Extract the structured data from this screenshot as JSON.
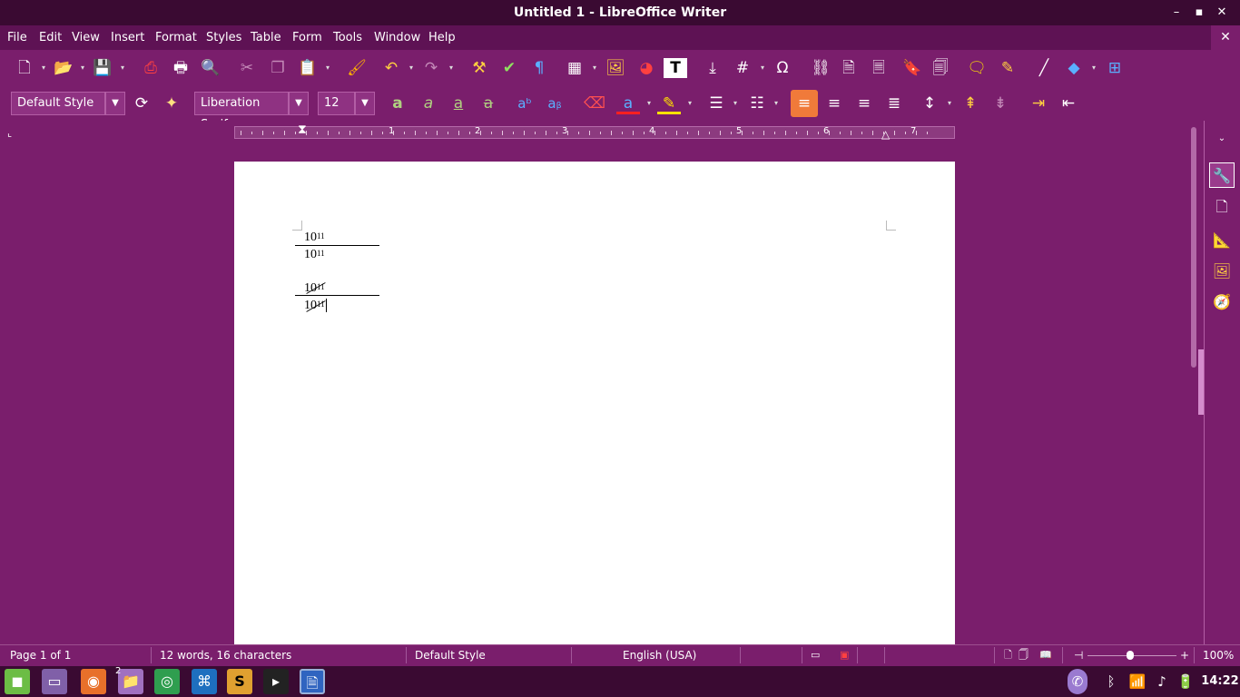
{
  "window": {
    "title": "Untitled 1 - LibreOffice Writer",
    "minimize": "–",
    "maximize": "▪",
    "close": "✕"
  },
  "menu": [
    "File",
    "Edit",
    "View",
    "Insert",
    "Format",
    "Styles",
    "Table",
    "Form",
    "Tools",
    "Window",
    "Help"
  ],
  "doc_close": "✕",
  "formatting": {
    "para_style": "Default Style",
    "font_name": "Liberation Serif",
    "font_size": "12"
  },
  "ruler": {
    "numbers": [
      "1",
      "2",
      "3",
      "4",
      "5",
      "6",
      "7"
    ]
  },
  "document": {
    "frac1_num": "10",
    "frac1_num_exp": "11",
    "frac1_den": "10",
    "frac1_den_exp": "11",
    "frac2_num": "10",
    "frac2_num_exp": "11",
    "frac2_den": "10",
    "frac2_den_exp": "11"
  },
  "status": {
    "page": "Page 1 of 1",
    "words": "12 words, 16 characters",
    "style": "Default Style",
    "language": "English (USA)",
    "zoom": "100%"
  },
  "clock": "14:22",
  "taskbar": {
    "files_badge": "2"
  },
  "colors": {
    "accent": "#7a1e6c",
    "titlebar": "#3a0a32",
    "active_button": "#f07a3a"
  }
}
